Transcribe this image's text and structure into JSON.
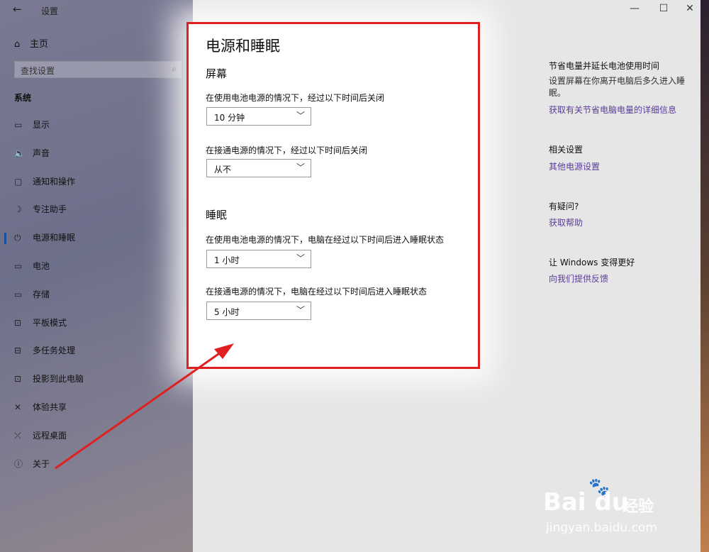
{
  "window": {
    "title": "设置",
    "back_icon": "←",
    "minimize": "—",
    "maximize": "☐",
    "close": "✕"
  },
  "sidebar": {
    "home_label": "主页",
    "search_placeholder": "查找设置",
    "section_title": "系统",
    "items": [
      {
        "label": "显示",
        "icon": "display-icon",
        "glyph": "▭"
      },
      {
        "label": "声音",
        "icon": "sound-icon",
        "glyph": "🔈"
      },
      {
        "label": "通知和操作",
        "icon": "notification-icon",
        "glyph": "▢"
      },
      {
        "label": "专注助手",
        "icon": "moon-icon",
        "glyph": "☽"
      },
      {
        "label": "电源和睡眠",
        "icon": "power-icon",
        "glyph": "⏻",
        "active": true
      },
      {
        "label": "电池",
        "icon": "battery-icon",
        "glyph": "▭"
      },
      {
        "label": "存储",
        "icon": "storage-icon",
        "glyph": "▭"
      },
      {
        "label": "平板模式",
        "icon": "tablet-icon",
        "glyph": "⊡"
      },
      {
        "label": "多任务处理",
        "icon": "multitask-icon",
        "glyph": "⊟"
      },
      {
        "label": "投影到此电脑",
        "icon": "project-icon",
        "glyph": "⊡"
      },
      {
        "label": "体验共享",
        "icon": "share-icon",
        "glyph": "✕"
      },
      {
        "label": "远程桌面",
        "icon": "remote-icon",
        "glyph": "⤫"
      },
      {
        "label": "关于",
        "icon": "info-icon",
        "glyph": "ⓘ"
      }
    ]
  },
  "panel": {
    "title": "电源和睡眠",
    "screen_section": "屏幕",
    "screen_battery_label": "在使用电池电源的情况下，经过以下时间后关闭",
    "screen_battery_value": "10 分钟",
    "screen_plugged_label": "在接通电源的情况下，经过以下时间后关闭",
    "screen_plugged_value": "从不",
    "sleep_section": "睡眠",
    "sleep_battery_label": "在使用电池电源的情况下，电脑在经过以下时间后进入睡眠状态",
    "sleep_battery_value": "1 小时",
    "sleep_plugged_label": "在接通电源的情况下，电脑在经过以下时间后进入睡眠状态",
    "sleep_plugged_value": "5 小时"
  },
  "right": {
    "save_title": "节省电量并延长电池使用时间",
    "save_text": "设置屏幕在你离开电脑后多久进入睡眠。",
    "save_link": "获取有关节省电脑电量的详细信息",
    "related_title": "相关设置",
    "related_link": "其他电源设置",
    "help_title": "有疑问?",
    "help_link": "获取帮助",
    "feedback_title": "让 Windows 变得更好",
    "feedback_link": "向我们提供反馈"
  },
  "watermark": {
    "logo": "Bai du",
    "cn": "经验",
    "url": "jingyan.baidu.com"
  },
  "colors": {
    "highlight_border": "#e02020",
    "link": "#5a3c9a",
    "annotation_arrow": "#e02020"
  }
}
